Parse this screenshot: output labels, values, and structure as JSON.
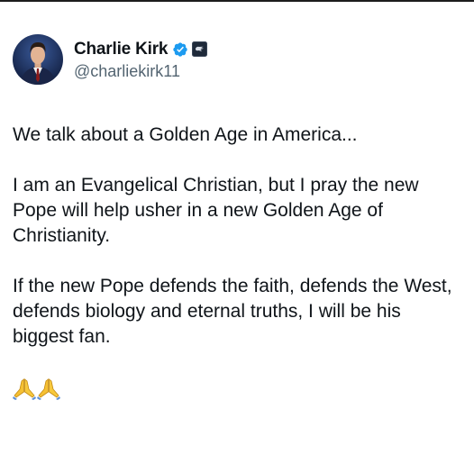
{
  "author": {
    "display_name": "Charlie Kirk",
    "handle": "@charliekirk11",
    "verified_icon": "verified-badge-icon",
    "affiliate_icon": "affiliate-badge-icon",
    "colors": {
      "verified": "#1d9bf0",
      "handle": "#536471",
      "text": "#0f1419"
    }
  },
  "tweet": {
    "paragraphs": [
      "We talk about a Golden Age in America...",
      "I am an Evangelical Christian, but I pray the new Pope will help usher in a new Golden Age of Christianity.",
      "If the new Pope defends the faith, defends the West, defends biology and eternal truths, I will be his biggest fan."
    ],
    "emojis": [
      "folded-hands-icon",
      "folded-hands-icon"
    ]
  }
}
